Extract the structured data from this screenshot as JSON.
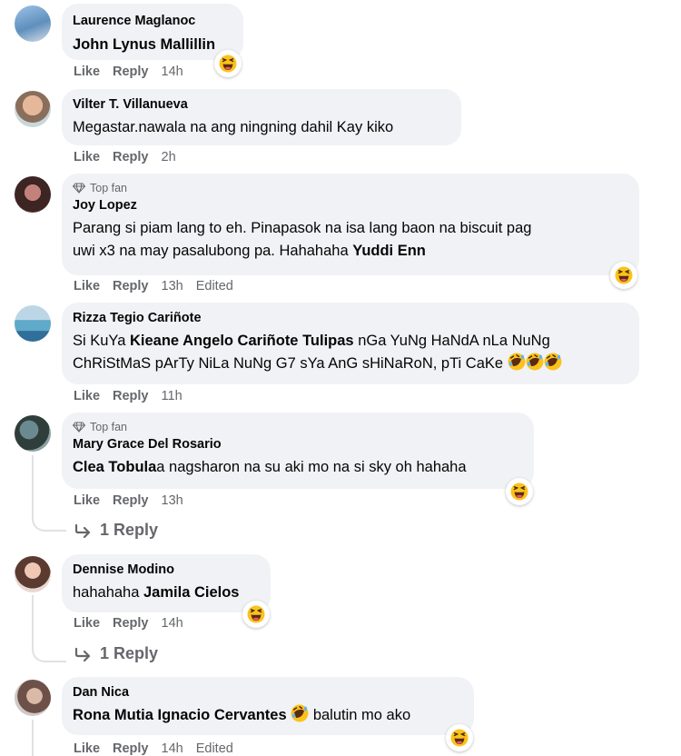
{
  "actions": {
    "like": "Like",
    "reply": "Reply"
  },
  "top_fan_label": "Top fan",
  "comments": [
    {
      "name": "Laurence Maglanoc",
      "mention": "John Lynus Mallillin",
      "time": "14h"
    },
    {
      "name": "Vilter T. Villanueva",
      "text": "Megastar.nawala na ang ningning dahil Kay kiko",
      "time": "2h"
    },
    {
      "name": "Joy Lopez",
      "text_line1": "Parang si piam lang to eh. Pinapasok na isa lang baon na biscuit pag",
      "text_line2": "uwi x3 na may pasalubong pa. Hahahaha ",
      "mention": "Yuddi Enn",
      "time": "13h",
      "edited": "Edited"
    },
    {
      "name": "Rizza Tegio Cariñote",
      "text_a": "Si KuYa ",
      "mention": "Kieane Angelo Cariñote Tulipas",
      "text_b": " nGa YuNg HaNdA nLa NuNg",
      "text_line2": "ChRiStMaS pArTy NiLa NuNg G7 sYa AnG sHiNaRoN, pTi CaKe ",
      "time": "11h"
    },
    {
      "name": "Mary Grace Del Rosario",
      "mention": "Clea Tobula",
      "text": "a nagsharon na su aki mo na si sky oh hahaha",
      "time": "13h",
      "replies": "1 Reply"
    },
    {
      "name": "Dennise Modino",
      "text": "hahahaha ",
      "mention": "Jamila Cielos",
      "time": "14h",
      "replies": "1 Reply"
    },
    {
      "name": "Dan Nica",
      "mention": "Rona Mutia Ignacio Cervantes",
      "text": " balutin mo ako",
      "time": "14h",
      "edited": "Edited"
    }
  ],
  "colors": {
    "bubble": "#f0f2f5",
    "secondary_text": "#65676b",
    "emoji_face": "#fcc21b"
  }
}
